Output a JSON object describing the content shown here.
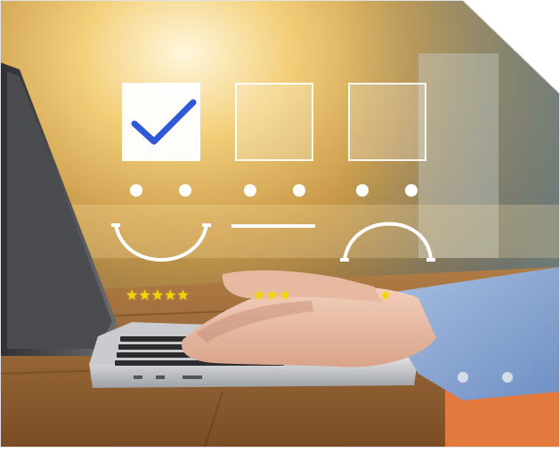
{
  "scene": {
    "description_colors": {
      "accent_check": "#2f59d6",
      "star": "#f5d500",
      "overlay": "#ffffff"
    },
    "rating_options": [
      {
        "face": "happy",
        "checked": true,
        "stars": 5
      },
      {
        "face": "neutral",
        "checked": false,
        "stars": 3
      },
      {
        "face": "sad",
        "checked": false,
        "stars": 1
      }
    ]
  },
  "icons": {
    "check": "check-icon",
    "star": "star-icon",
    "face_happy": "happy-face-icon",
    "face_neutral": "neutral-face-icon",
    "face_sad": "sad-face-icon"
  }
}
